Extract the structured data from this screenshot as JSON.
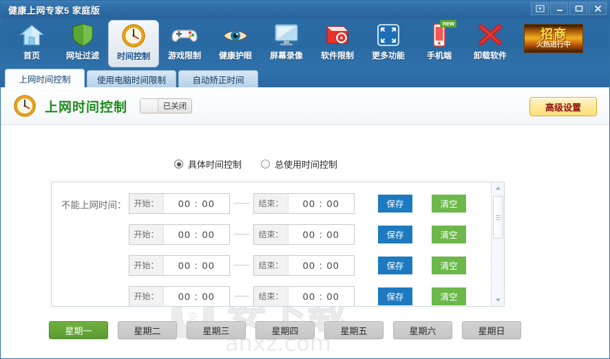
{
  "window": {
    "title": "健康上网专家5 家庭版",
    "controls": [
      {
        "name": "collapse",
        "glyph": "▼"
      },
      {
        "name": "minimize",
        "glyph": "—"
      },
      {
        "name": "maximize",
        "glyph": "▭"
      },
      {
        "name": "close",
        "glyph": "✕"
      }
    ]
  },
  "toolbar": {
    "items": [
      {
        "label": "首页",
        "icon": "home-icon",
        "active": false
      },
      {
        "label": "网址过滤",
        "icon": "shield-icon",
        "active": false
      },
      {
        "label": "时间控制",
        "icon": "clock-icon",
        "active": true
      },
      {
        "label": "游戏限制",
        "icon": "gamepad-icon",
        "active": false
      },
      {
        "label": "健康护眼",
        "icon": "eye-icon",
        "active": false
      },
      {
        "label": "屏幕录像",
        "icon": "monitor-icon",
        "active": false
      },
      {
        "label": "软件限制",
        "icon": "disc-icon",
        "active": false
      },
      {
        "label": "更多功能",
        "icon": "grid-arrows-icon",
        "active": false
      },
      {
        "label": "手机端",
        "icon": "phone-icon",
        "active": false,
        "badge": "new"
      },
      {
        "label": "卸载软件",
        "icon": "red-x-icon",
        "active": false
      }
    ],
    "ad": {
      "top_text": "招商",
      "bottom_text": "火热进行中"
    }
  },
  "tabs": [
    {
      "label": "上网时间控制",
      "active": true
    },
    {
      "label": "使用电脑时间限制",
      "active": false
    },
    {
      "label": "自动矫正时间",
      "active": false
    }
  ],
  "section": {
    "title": "上网时间控制",
    "title_color": "#1b8a1b",
    "toggle_label": "已关闭",
    "toggle_state": "off",
    "advanced_button": "高级设置",
    "advanced_button_color": "#ffe89a"
  },
  "modes": [
    {
      "label": "具体时间控制",
      "selected": true
    },
    {
      "label": "总使用时间控制",
      "selected": false
    }
  ],
  "panel": {
    "row_label": "不能上网时间：",
    "start_label": "开始：",
    "end_label": "结束：",
    "save_label": "保存",
    "clear_label": "清空",
    "save_color": "#1d7ac0",
    "clear_color": "#6cb84a",
    "rows": [
      {
        "start": "00 : 00",
        "end": "00 : 00"
      },
      {
        "start": "00 : 00",
        "end": "00 : 00"
      },
      {
        "start": "00 : 00",
        "end": "00 : 00"
      },
      {
        "start": "00 : 00",
        "end": "00 : 00"
      }
    ]
  },
  "days": [
    {
      "label": "星期一",
      "active": true
    },
    {
      "label": "星期二",
      "active": false
    },
    {
      "label": "星期三",
      "active": false
    },
    {
      "label": "星期四",
      "active": false
    },
    {
      "label": "星期五",
      "active": false
    },
    {
      "label": "星期六",
      "active": false
    },
    {
      "label": "星期日",
      "active": false
    }
  ],
  "watermark": {
    "main_text": "安下载",
    "url_text": "anxz.com"
  }
}
